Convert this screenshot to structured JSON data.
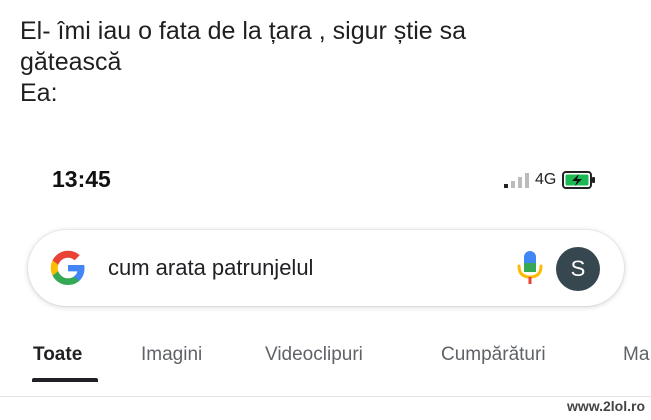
{
  "caption": {
    "line1": "El- îmi iau o fata de la țara , sigur știe sa",
    "line2": "gătească",
    "line3": "Ea:"
  },
  "status_bar": {
    "time": "13:45",
    "network": "4G",
    "icons": [
      "signal-icon",
      "battery-charging-icon"
    ]
  },
  "search": {
    "query": "cum arata patrunjelul",
    "avatar_letter": "S",
    "icons": [
      "google-logo-icon",
      "microphone-icon"
    ]
  },
  "tabs": [
    {
      "label": "Toate",
      "active": true
    },
    {
      "label": "Imagini",
      "active": false
    },
    {
      "label": "Videoclipuri",
      "active": false
    },
    {
      "label": "Cumpărături",
      "active": false
    },
    {
      "label": "Ma",
      "active": false
    }
  ],
  "watermark": "www.2lol.ro",
  "colors": {
    "google_blue": "#4285F4",
    "google_red": "#EA4335",
    "google_yellow": "#FBBC05",
    "google_green": "#34A853",
    "avatar_bg": "#37474f",
    "battery_green": "#1db954"
  }
}
